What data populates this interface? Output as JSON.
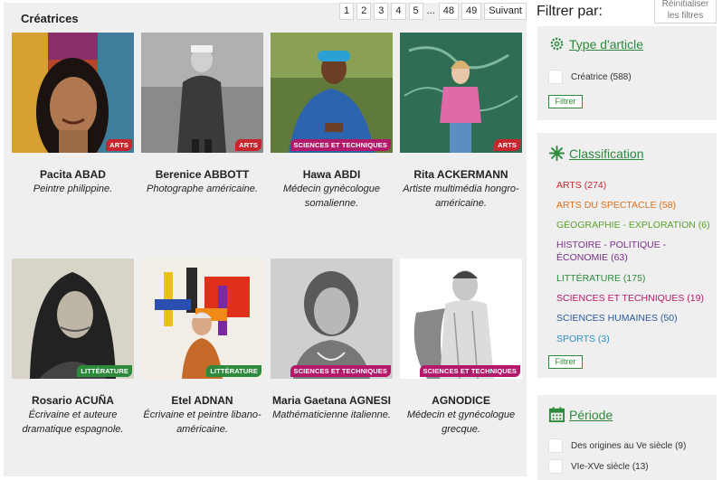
{
  "main": {
    "title": "Créatrices",
    "pagination": {
      "pages": [
        "1",
        "2",
        "3",
        "4",
        "5"
      ],
      "ellipsis": "...",
      "last_pages": [
        "48",
        "49"
      ],
      "next": "Suivant"
    },
    "cards": [
      {
        "name": "Pacita ABAD",
        "desc": "Peintre philippine.",
        "badge": "ARTS",
        "badge_type": "arts"
      },
      {
        "name": "Berenice ABBOTT",
        "desc": "Photographe américaine.",
        "badge": "ARTS",
        "badge_type": "arts"
      },
      {
        "name": "Hawa ABDI",
        "desc": "Médecin gynécologue somalienne.",
        "badge": "SCIENCES ET TECHNIQUES",
        "badge_type": "sciences"
      },
      {
        "name": "Rita ACKERMANN",
        "desc": "Artiste multimédia hongro-américaine.",
        "badge": "ARTS",
        "badge_type": "arts"
      },
      {
        "name": "Rosario ACUÑA",
        "desc": "Écrivaine et auteure dramatique espagnole.",
        "badge": "LITTÉRATURE",
        "badge_type": "litterature"
      },
      {
        "name": "Etel ADNAN",
        "desc": "Écrivaine et peintre libano-américaine.",
        "badge": "LITTÉRATURE",
        "badge_type": "litterature"
      },
      {
        "name": "Maria Gaetana AGNESI",
        "desc": "Mathématicienne italienne.",
        "badge": "SCIENCES ET TECHNIQUES",
        "badge_type": "sciences"
      },
      {
        "name": "AGNODICE",
        "desc": "Médecin et gynécologue grecque.",
        "badge": "SCIENCES ET TECHNIQUES",
        "badge_type": "sciences"
      }
    ]
  },
  "sidebar": {
    "heading": "Filtrer par:",
    "reset": "Réinitialiser les filtres",
    "type_box": {
      "title": "Type d'article",
      "icon": "gear-icon",
      "options": [
        {
          "label": "Créatrice (588)"
        }
      ],
      "filter_label": "Filtrer"
    },
    "classification_box": {
      "title": "Classification",
      "icon": "snowflake-icon",
      "items": [
        {
          "label": "ARTS (274)",
          "color": "#c9252d"
        },
        {
          "label": "ARTS DU SPECTACLE (58)",
          "color": "#e0701a"
        },
        {
          "label": "GÉOGRAPHIE - EXPLORATION (6)",
          "color": "#5aa02c"
        },
        {
          "label": "HISTOIRE - POLITIQUE - ÉCONOMIE (63)",
          "color": "#7a2f8a"
        },
        {
          "label": "LITTÉRATURE (175)",
          "color": "#2c8a3a"
        },
        {
          "label": "SCIENCES ET TECHNIQUES (19)",
          "color": "#b3186a"
        },
        {
          "label": "SCIENCES HUMAINES (50)",
          "color": "#2b5a9a"
        },
        {
          "label": "SPORTS (3)",
          "color": "#2a8fc4"
        }
      ],
      "filter_label": "Filtrer"
    },
    "period_box": {
      "title": "Période",
      "icon": "calendar-icon",
      "options": [
        {
          "label": "Des origines au Ve siècle (9)"
        },
        {
          "label": "VIe-XVe siècle (13)"
        }
      ]
    }
  }
}
